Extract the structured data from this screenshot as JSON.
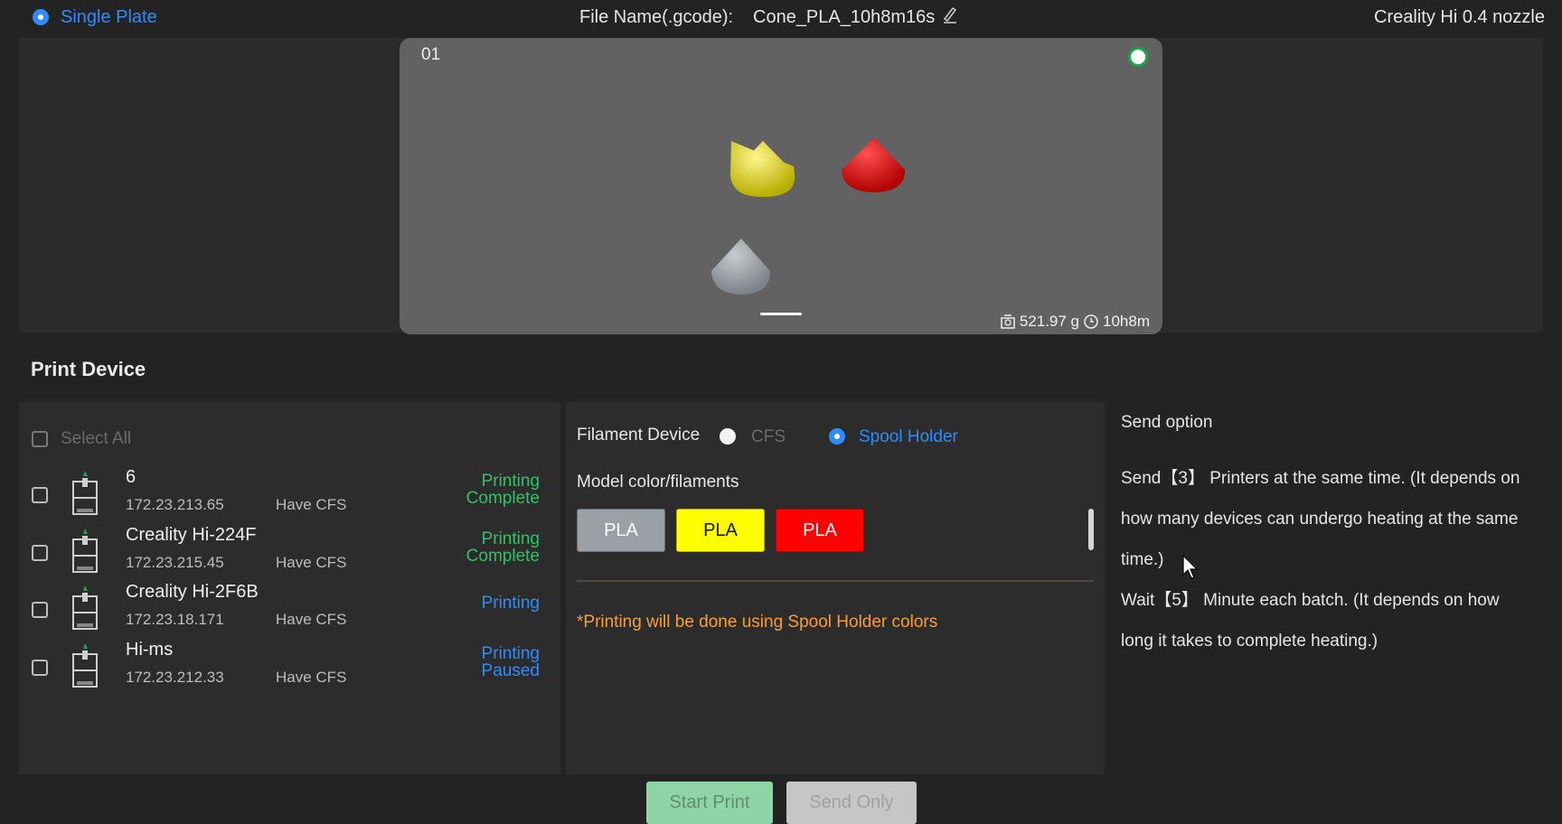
{
  "top_bar": {
    "plate_mode": "Single Plate",
    "file_name_label": "File Name(.gcode):",
    "file_name_value": "Cone_PLA_10h8m16s",
    "printer_preset": "Creality Hi 0.4 nozzle"
  },
  "plate": {
    "number": "01",
    "weight": "521.97 g",
    "time": "10h8m",
    "objects": [
      {
        "name": "yellow-cone",
        "color": "#e6df0a"
      },
      {
        "name": "red-cone",
        "color": "#e00a0a"
      },
      {
        "name": "gray-cone",
        "color": "#9aa0a6"
      }
    ]
  },
  "print_device": {
    "title": "Print Device",
    "select_all": "Select All",
    "devices": [
      {
        "name": "6",
        "ip": "172.23.213.65",
        "cfs": "Have CFS",
        "status_line1": "Printing",
        "status_line2": "Complete",
        "status_color": "#2ec26a"
      },
      {
        "name": "Creality Hi-224F",
        "ip": "172.23.215.45",
        "cfs": "Have CFS",
        "status_line1": "Printing",
        "status_line2": "Complete",
        "status_color": "#2ec26a"
      },
      {
        "name": "Creality Hi-2F6B",
        "ip": "172.23.18.171",
        "cfs": "Have CFS",
        "status_line1": "Printing",
        "status_line2": "",
        "status_color": "#2f8cff"
      },
      {
        "name": "Hi-ms",
        "ip": "172.23.212.33",
        "cfs": "Have CFS",
        "status_line1": "Printing",
        "status_line2": "Paused",
        "status_color": "#2f8cff"
      }
    ]
  },
  "filament": {
    "device_label": "Filament Device",
    "option_cfs": "CFS",
    "option_spool": "Spool Holder",
    "model_colors_label": "Model color/filaments",
    "chips": [
      {
        "label": "PLA",
        "bg": "#9aa0a6",
        "fg": "#ffffff"
      },
      {
        "label": "PLA",
        "bg": "#ffff00",
        "fg": "#111111"
      },
      {
        "label": "PLA",
        "bg": "#ff0000",
        "fg": "#ffffff"
      }
    ],
    "note": "*Printing will be done using Spool Holder colors"
  },
  "send_option": {
    "title": "Send option",
    "line1": "Send【3】 Printers at the same time. (It depends on",
    "line2": "how many devices can undergo heating at the same",
    "line3": "time.)",
    "line4": "Wait【5】 Minute each batch. (It depends on how",
    "line5": "long it takes to complete heating.)"
  },
  "buttons": {
    "start_print": "Start Print",
    "send_only": "Send Only"
  },
  "colors": {
    "accent_blue": "#2f8cff",
    "success_green": "#2ec26a",
    "note_orange": "#ff9d2e"
  }
}
